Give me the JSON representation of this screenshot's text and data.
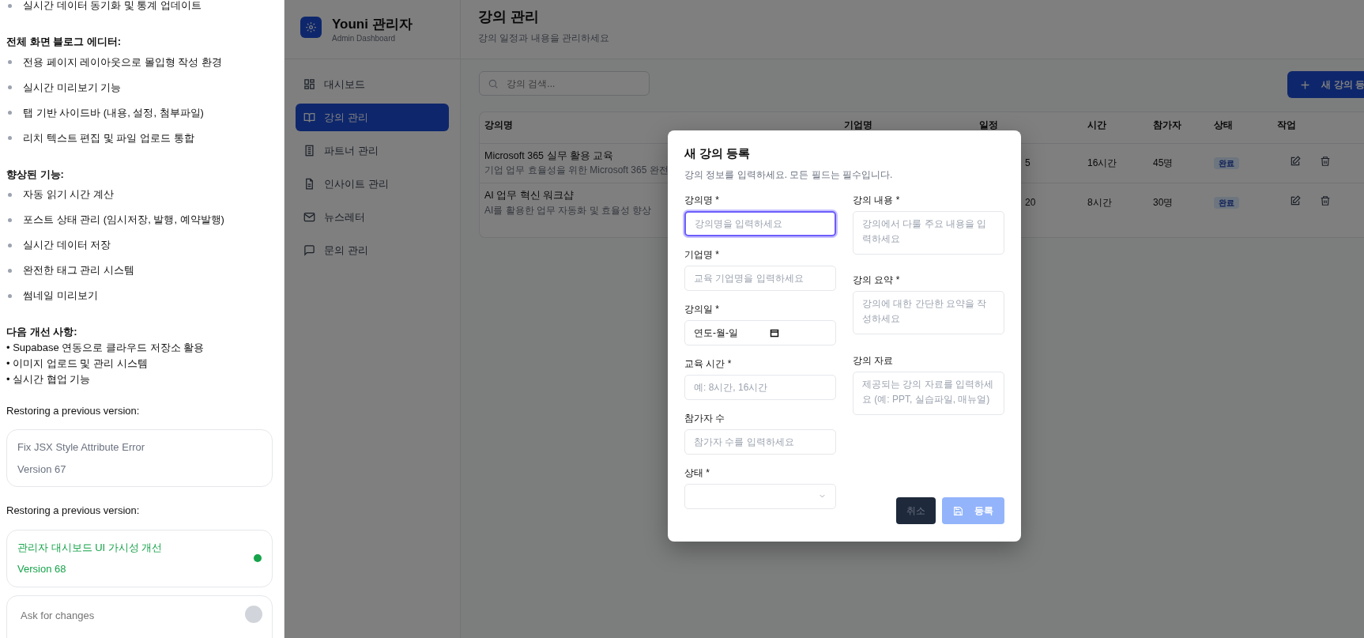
{
  "chat": {
    "top_item": "실시간 데이터 동기화 및 통계 업데이트",
    "sections": [
      {
        "heading": "전체 화면 블로그 에디터:",
        "kind": "spaced",
        "items": [
          "전용 페이지 레이아웃으로 몰입형 작성 환경",
          "실시간 미리보기 기능",
          "탭 기반 사이드바 (내용, 설정, 첨부파일)",
          "리치 텍스트 편집 및 파일 업로드 통합"
        ]
      },
      {
        "heading": "향상된 기능:",
        "kind": "spaced",
        "items": [
          "자동 읽기 시간 계산",
          "포스트 상태 관리 (임시저장, 발행, 예약발행)",
          "실시간 데이터 저장",
          "완전한 태그 관리 시스템",
          "썸네일 미리보기"
        ]
      },
      {
        "heading": "다음 개선 사항:",
        "kind": "compact",
        "items": [
          "• Supabase 연동으로 클라우드 저장소 활용",
          "• 이미지 업로드 및 관리 시스템",
          "• 실시간 협업 기능"
        ]
      }
    ],
    "restores": [
      {
        "label": "Restoring a previous version:",
        "title": "Fix JSX Style Attribute Error",
        "version": "Version 67",
        "selected": false
      },
      {
        "label": "Restoring a previous version:",
        "title": "관리자 대시보드 UI 가시성 개선",
        "version": "Version 68",
        "selected": true
      }
    ],
    "input": {
      "placeholder": "Ask for changes"
    }
  },
  "admin": {
    "brand": {
      "title": "Youni 관리자",
      "subtitle": "Admin Dashboard"
    },
    "nav": [
      {
        "label": "대시보드",
        "kind": "grid",
        "selected": false
      },
      {
        "label": "강의 관리",
        "kind": "book",
        "selected": true
      },
      {
        "label": "파트너 관리",
        "kind": "building",
        "selected": false
      },
      {
        "label": "인사이트 관리",
        "kind": "document",
        "selected": false
      },
      {
        "label": "뉴스레터",
        "kind": "mail",
        "selected": false
      },
      {
        "label": "문의 관리",
        "kind": "chat",
        "selected": false
      }
    ],
    "header": {
      "title": "강의 관리",
      "subtitle": "강의 일정과 내용을 관리하세요"
    },
    "search": {
      "placeholder": "강의 검색..."
    },
    "new_button": "새 강의 등",
    "table": {
      "columns": [
        "강의명",
        "기업명",
        "일정",
        "시간",
        "참가자",
        "상태",
        "작업"
      ],
      "rows": [
        {
          "title": "Microsoft 365 실무 활용 교육",
          "description": "기업 업무 효율성을 위한 Microsoft 365 완전",
          "column_3": "5",
          "hours": "16시간",
          "participants": "45명",
          "status": "완료"
        },
        {
          "title": "AI 업무 혁신 워크샵",
          "description": "AI를 활용한 업무 자동화 및 효율성 향상",
          "column_3": "20",
          "hours": "8시간",
          "participants": "30명",
          "status": "완료"
        }
      ]
    }
  },
  "modal": {
    "title": "새 강의 등록",
    "subtitle": "강의 정보를 입력하세요. 모든 필드는 필수입니다.",
    "left_fields": [
      {
        "label": "강의명 *",
        "kind": "text",
        "placeholder": "강의명을 입력하세요",
        "focused": true
      },
      {
        "label": "기업명 *",
        "kind": "text",
        "placeholder": "교육 기업명을 입력하세요",
        "focused": false
      },
      {
        "label": "강의일 *",
        "kind": "date",
        "value": "연도-월-일",
        "focused": false
      },
      {
        "label": "교육 시간 *",
        "kind": "text",
        "placeholder": "예: 8시간, 16시간",
        "focused": false
      },
      {
        "label": "참가자 수",
        "kind": "text",
        "placeholder": "참가자 수를 입력하세요",
        "focused": false
      },
      {
        "label": "상태 *",
        "kind": "select",
        "focused": false
      }
    ],
    "right_fields": [
      {
        "label": "강의 내용 *",
        "kind": "textarea",
        "placeholder": "강의에서 다룰 주요 내용을 입력하세요",
        "focused": false
      },
      {
        "label": "강의 요약 *",
        "kind": "textarea",
        "placeholder": "강의에 대한 간단한 요약을 작성하세요",
        "focused": false
      },
      {
        "label": "강의 자료",
        "kind": "textarea",
        "placeholder": "제공되는 강의 자료를 입력하세요 (예: PPT, 실습파일, 매뉴얼)",
        "focused": false
      }
    ],
    "buttons": [
      {
        "label": "취소",
        "kind": "cancel",
        "disabled": false
      },
      {
        "label": "등록",
        "kind": "submit",
        "disabled": true
      }
    ]
  }
}
